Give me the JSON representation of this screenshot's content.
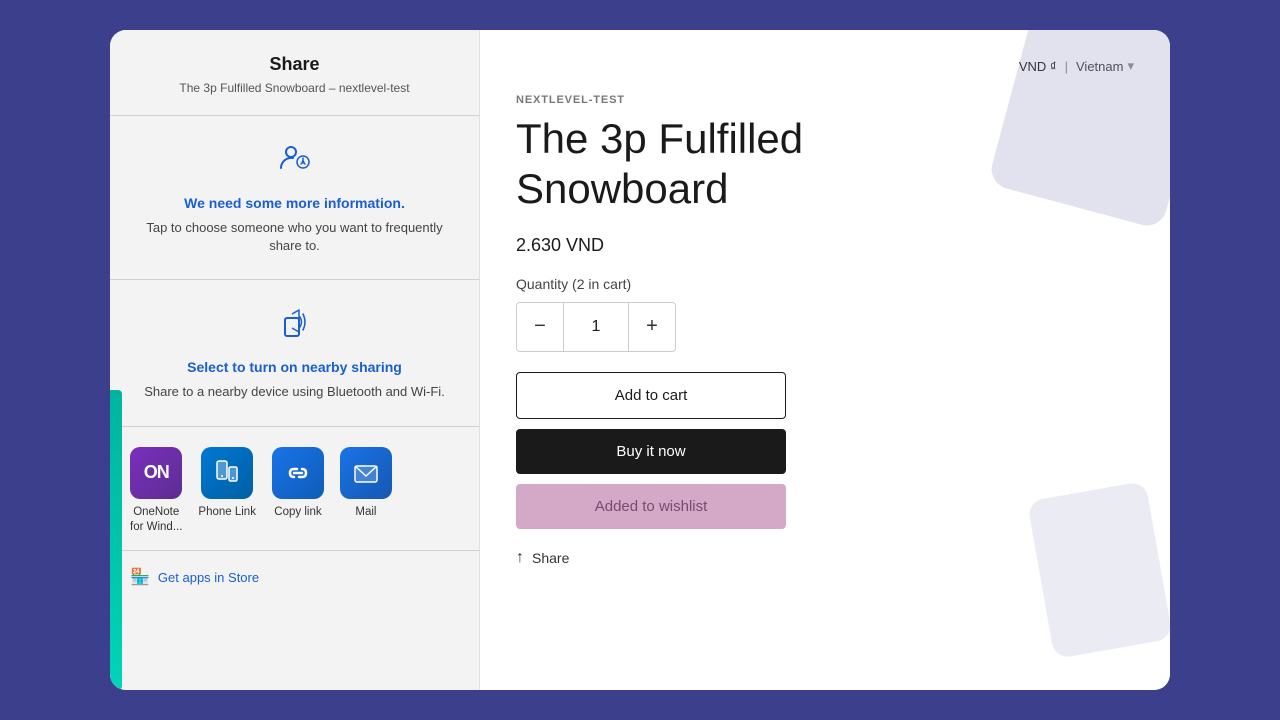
{
  "share_panel": {
    "header": {
      "title": "Share",
      "subtitle": "The 3p Fulfilled Snowboard – nextlevel-test"
    },
    "more_info_section": {
      "icon": "👤",
      "title": "We need some more information.",
      "description": "Tap to choose someone who you want to frequently share to."
    },
    "nearby_section": {
      "icon": "📤",
      "title": "Select to turn on nearby sharing",
      "description": "Share to a nearby device using Bluetooth and Wi-Fi."
    },
    "apps": [
      {
        "name": "OneNote for Windo",
        "label": "OneNote\nfor Wind..."
      },
      {
        "name": "Phone Link",
        "label": "Phone Link"
      },
      {
        "name": "Copy link",
        "label": "Copy link"
      },
      {
        "name": "Mail",
        "label": "Mail"
      }
    ],
    "store_link": "Get apps in Store"
  },
  "product_panel": {
    "currency": "VND ₫",
    "region": "Vietnam",
    "store_label": "NEXTLEVEL-TEST",
    "product_title": "The 3p Fulfilled\nSnowboard",
    "price": "2.630 VND",
    "quantity_label": "Quantity (2 in cart)",
    "quantity_value": "1",
    "btn_add_to_cart": "Add to cart",
    "btn_buy_now": "Buy it now",
    "btn_wishlist": "Added to wishlist",
    "share_label": "Share"
  }
}
